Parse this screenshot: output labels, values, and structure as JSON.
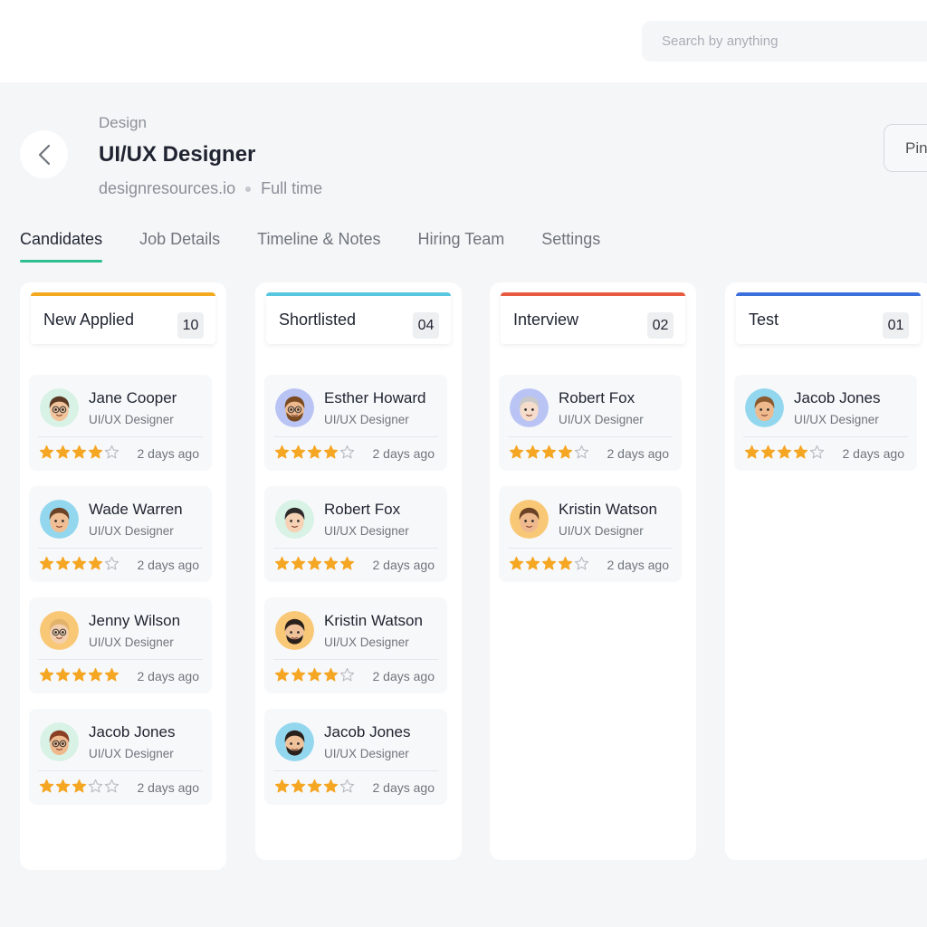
{
  "search": {
    "placeholder": "Search by anything"
  },
  "header": {
    "category": "Design",
    "title": "UI/UX Designer",
    "company": "designresources.io",
    "employment": "Full time",
    "pin_label": "Pin"
  },
  "tabs": [
    {
      "label": "Candidates",
      "active": true
    },
    {
      "label": "Job Details",
      "active": false
    },
    {
      "label": "Timeline & Notes",
      "active": false
    },
    {
      "label": "Hiring Team",
      "active": false
    },
    {
      "label": "Settings",
      "active": false
    }
  ],
  "colors": {
    "accent": "#2fbf8f",
    "star": "#f5a623",
    "star_empty": "#b8bcc2"
  },
  "columns": [
    {
      "name": "New Applied",
      "count": "10",
      "color": "#f2a91e",
      "cards": [
        {
          "name": "Jane Cooper",
          "role": "UI/UX Designer",
          "rating": 4,
          "time": "2 days ago",
          "avatar_bg": "#d8f2e6",
          "skin": "#f2c49b",
          "hair": "#5a3a24",
          "glasses": true,
          "beard": false
        },
        {
          "name": "Wade Warren",
          "role": "UI/UX Designer",
          "rating": 4,
          "time": "2 days ago",
          "avatar_bg": "#93d7ef",
          "skin": "#f0be95",
          "hair": "#6b4226",
          "glasses": false,
          "beard": false
        },
        {
          "name": "Jenny Wilson",
          "role": "UI/UX Designer",
          "rating": 5,
          "time": "2 days ago",
          "avatar_bg": "#f9c876",
          "skin": "#f4cfae",
          "hair": "#e2b36a",
          "glasses": true,
          "beard": false
        },
        {
          "name": "Jacob Jones",
          "role": "UI/UX Designer",
          "rating": 3,
          "time": "2 days ago",
          "avatar_bg": "#d8f2e6",
          "skin": "#efb98e",
          "hair": "#8a3f24",
          "glasses": true,
          "beard": false
        }
      ]
    },
    {
      "name": "Shortlisted",
      "count": "04",
      "color": "#56c7de",
      "cards": [
        {
          "name": "Esther Howard",
          "role": "UI/UX Designer",
          "rating": 4,
          "time": "2 days ago",
          "avatar_bg": "#b9c4f4",
          "skin": "#efb98e",
          "hair": "#7a4a22",
          "glasses": true,
          "beard": true
        },
        {
          "name": "Robert Fox",
          "role": "UI/UX Designer",
          "rating": 5,
          "time": "2 days ago",
          "avatar_bg": "#d8f2e6",
          "skin": "#f6d1b4",
          "hair": "#2f2a2a",
          "glasses": false,
          "beard": false
        },
        {
          "name": "Kristin Watson",
          "role": "UI/UX Designer",
          "rating": 4,
          "time": "2 days ago",
          "avatar_bg": "#f9c876",
          "skin": "#f0c29a",
          "hair": "#2a211c",
          "glasses": false,
          "beard": true
        },
        {
          "name": "Jacob Jones",
          "role": "UI/UX Designer",
          "rating": 4,
          "time": "2 days ago",
          "avatar_bg": "#93d7ef",
          "skin": "#f0c29a",
          "hair": "#2a211c",
          "glasses": false,
          "beard": true
        }
      ]
    },
    {
      "name": "Interview",
      "count": "02",
      "color": "#e85a40",
      "cards": [
        {
          "name": "Robert Fox",
          "role": "UI/UX Designer",
          "rating": 4,
          "time": "2 days ago",
          "avatar_bg": "#b9c4f4",
          "skin": "#f6dccb",
          "hair": "#c9c9c9",
          "glasses": false,
          "beard": false
        },
        {
          "name": "Kristin Watson",
          "role": "UI/UX Designer",
          "rating": 4,
          "time": "2 days ago",
          "avatar_bg": "#f9c876",
          "skin": "#efb98e",
          "hair": "#6b4226",
          "glasses": false,
          "beard": false
        }
      ]
    },
    {
      "name": "Test",
      "count": "01",
      "color": "#3b6fdc",
      "cards": [
        {
          "name": "Jacob Jones",
          "role": "UI/UX Designer",
          "rating": 4,
          "time": "2 days ago",
          "avatar_bg": "#93d7ef",
          "skin": "#efb98e",
          "hair": "#8a5a30",
          "glasses": false,
          "beard": false
        }
      ]
    }
  ]
}
